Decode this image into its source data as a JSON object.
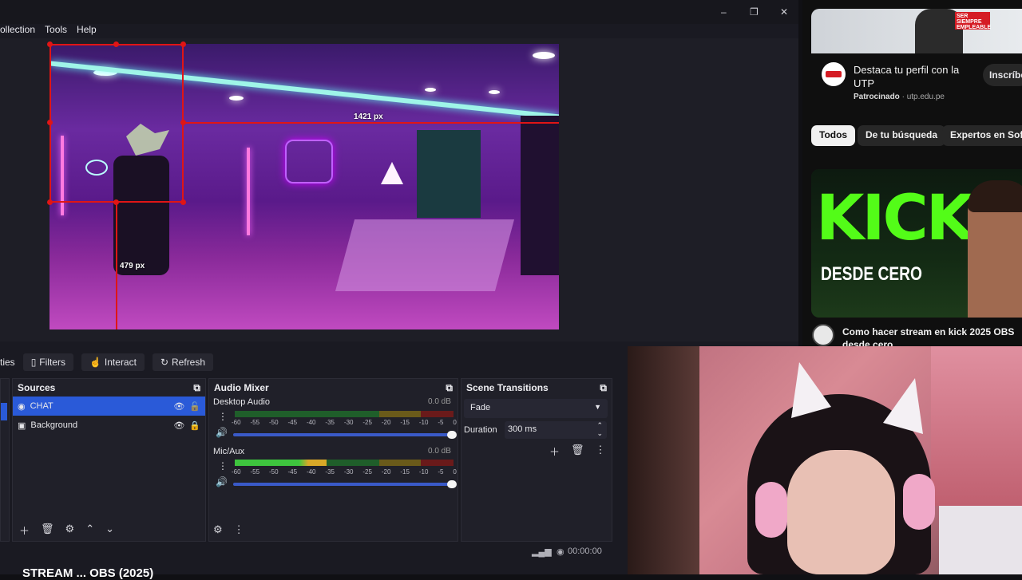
{
  "window": {
    "minimize": "–",
    "maximize": "❐",
    "close": "✕"
  },
  "menu": [
    "ollection",
    "Tools",
    "Help"
  ],
  "preview": {
    "width_label": "1421 px",
    "height_label": "479 px"
  },
  "toolbar": {
    "properties_partial": "ties",
    "filters": "Filters",
    "interact": "Interact",
    "refresh": "Refresh"
  },
  "sources": {
    "title": "Sources",
    "items": [
      {
        "name": "CHAT",
        "selected": true
      },
      {
        "name": "Background",
        "selected": false
      }
    ]
  },
  "mixer": {
    "title": "Audio Mixer",
    "channels": [
      {
        "name": "Desktop Audio",
        "db": "0.0 dB",
        "level": 0.0,
        "volume": 1.0
      },
      {
        "name": "Mic/Aux",
        "db": "0.0 dB",
        "level": 0.42,
        "volume": 1.0
      }
    ],
    "ticks": [
      "-60",
      "-55",
      "-50",
      "-45",
      "-40",
      "-35",
      "-30",
      "-25",
      "-20",
      "-15",
      "-10",
      "-5",
      "0"
    ]
  },
  "transitions": {
    "title": "Scene Transitions",
    "selected": "Fade",
    "duration_label": "Duration",
    "duration_value": "300 ms"
  },
  "status": {
    "time": "00:00:00"
  },
  "bottom_text": "STREAM ... OBS (2025)",
  "youtube": {
    "ad": {
      "title": "Destaca tu perfil con la UTP",
      "sponsor": "Patrocinado",
      "domain": "utp.edu.pe",
      "cta": "Inscríbe",
      "banner_text": "SER SIEMPRE EMPLEABLE"
    },
    "chips": [
      "Todos",
      "De tu búsqueda",
      "Expertos en Softw"
    ],
    "video": {
      "thumb_big": "KICK",
      "thumb_sub": "DESDE CERO",
      "title": "Como hacer stream en kick 2025 OBS desde cero"
    }
  },
  "colors": {
    "accent": "#2a5ad8",
    "red_guide": "#e01515",
    "yt_bg": "#0f0f0f",
    "kick_green": "#53fc18"
  }
}
